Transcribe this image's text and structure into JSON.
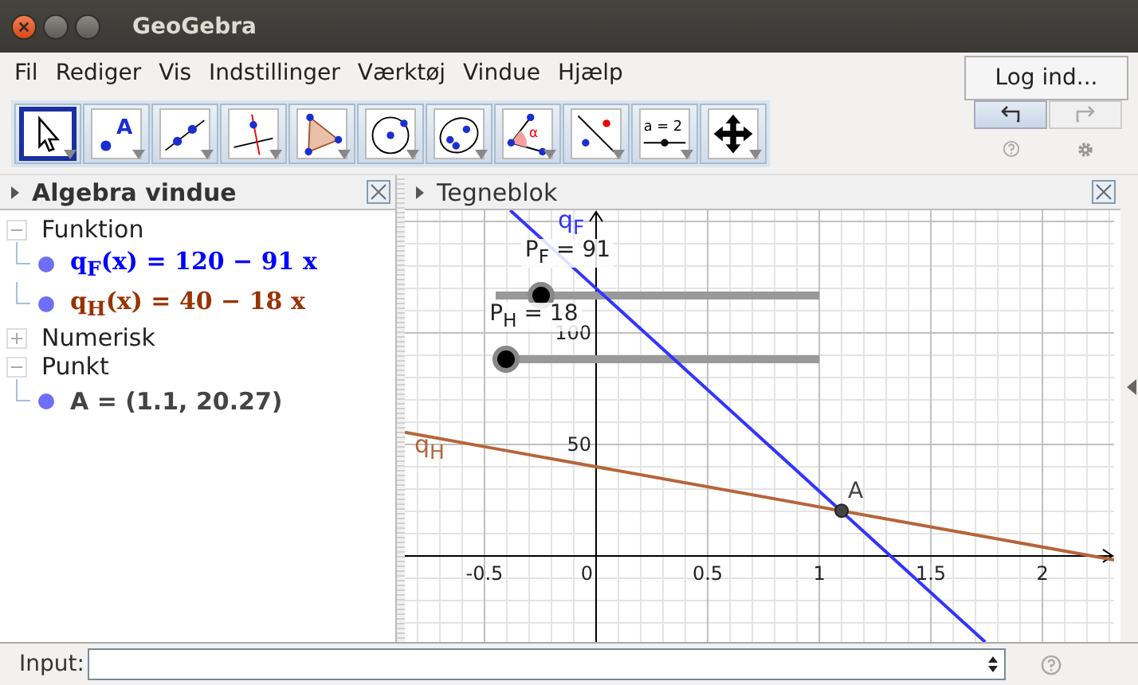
{
  "window": {
    "title": "GeoGebra"
  },
  "menu": [
    "Fil",
    "Rediger",
    "Vis",
    "Indstillinger",
    "Værktøj",
    "Vindue",
    "Hjælp"
  ],
  "login_button": "Log ind...",
  "tools": [
    {
      "kind": "move",
      "selected": true
    },
    {
      "kind": "point",
      "selected": false,
      "label": "A"
    },
    {
      "kind": "line",
      "selected": false
    },
    {
      "kind": "perpendicular",
      "selected": false
    },
    {
      "kind": "polygon",
      "selected": false
    },
    {
      "kind": "circle",
      "selected": false
    },
    {
      "kind": "conic",
      "selected": false
    },
    {
      "kind": "angle",
      "selected": false,
      "label": "α"
    },
    {
      "kind": "reflect",
      "selected": false
    },
    {
      "kind": "slider",
      "selected": false,
      "label": "a = 2"
    },
    {
      "kind": "pan",
      "selected": false
    }
  ],
  "history": [
    {
      "kind": "undo",
      "disabled": false
    },
    {
      "kind": "redo",
      "disabled": true
    }
  ],
  "algebra": {
    "title": "Algebra vindue",
    "groups": [
      {
        "label": "Funktion",
        "expanded": true,
        "children": [
          {
            "kind": "function",
            "text": "q$_{F}$(x) = 120 − 91 x",
            "color": "#0000ff"
          },
          {
            "kind": "function",
            "text": "q$_{H}$(x) = 40 − 18 x",
            "color": "#993300"
          }
        ]
      },
      {
        "label": "Numerisk",
        "expanded": false
      },
      {
        "label": "Punkt",
        "expanded": true,
        "children": [
          {
            "kind": "point",
            "text": "A = (1.1, 20.27)",
            "color": "#444444"
          }
        ]
      }
    ]
  },
  "graphics": {
    "title": "Tegneblok",
    "sliders": [
      {
        "label": "P$_{F}$ = 91",
        "level": 0.14
      },
      {
        "label": "P$_{H}$ = 18",
        "level": 0.03
      }
    ],
    "chart_data": {
      "type": "line",
      "x": [
        -0.857,
        -0.385,
        1.743,
        2.321
      ],
      "series": [
        {
          "name": "q$_{F}$",
          "color": "#3333ff",
          "values": [
            null,
            155.0,
            -38.6,
            null
          ]
        },
        {
          "name": "q$_{H}$",
          "color": "#b5653a",
          "values": [
            55.4,
            46.9,
            8.6,
            -1.8
          ]
        }
      ],
      "xlim": [
        -0.857,
        2.321
      ],
      "ylim": [
        -38.6,
        155
      ],
      "xticks": [
        -0.5,
        0,
        0.5,
        1,
        1.5,
        2
      ],
      "yticks": [
        50,
        100
      ],
      "grid": true,
      "annotations": [
        {
          "text": "A",
          "x": 1.1,
          "y": 20.27
        }
      ]
    }
  },
  "input": {
    "label": "Input:"
  }
}
